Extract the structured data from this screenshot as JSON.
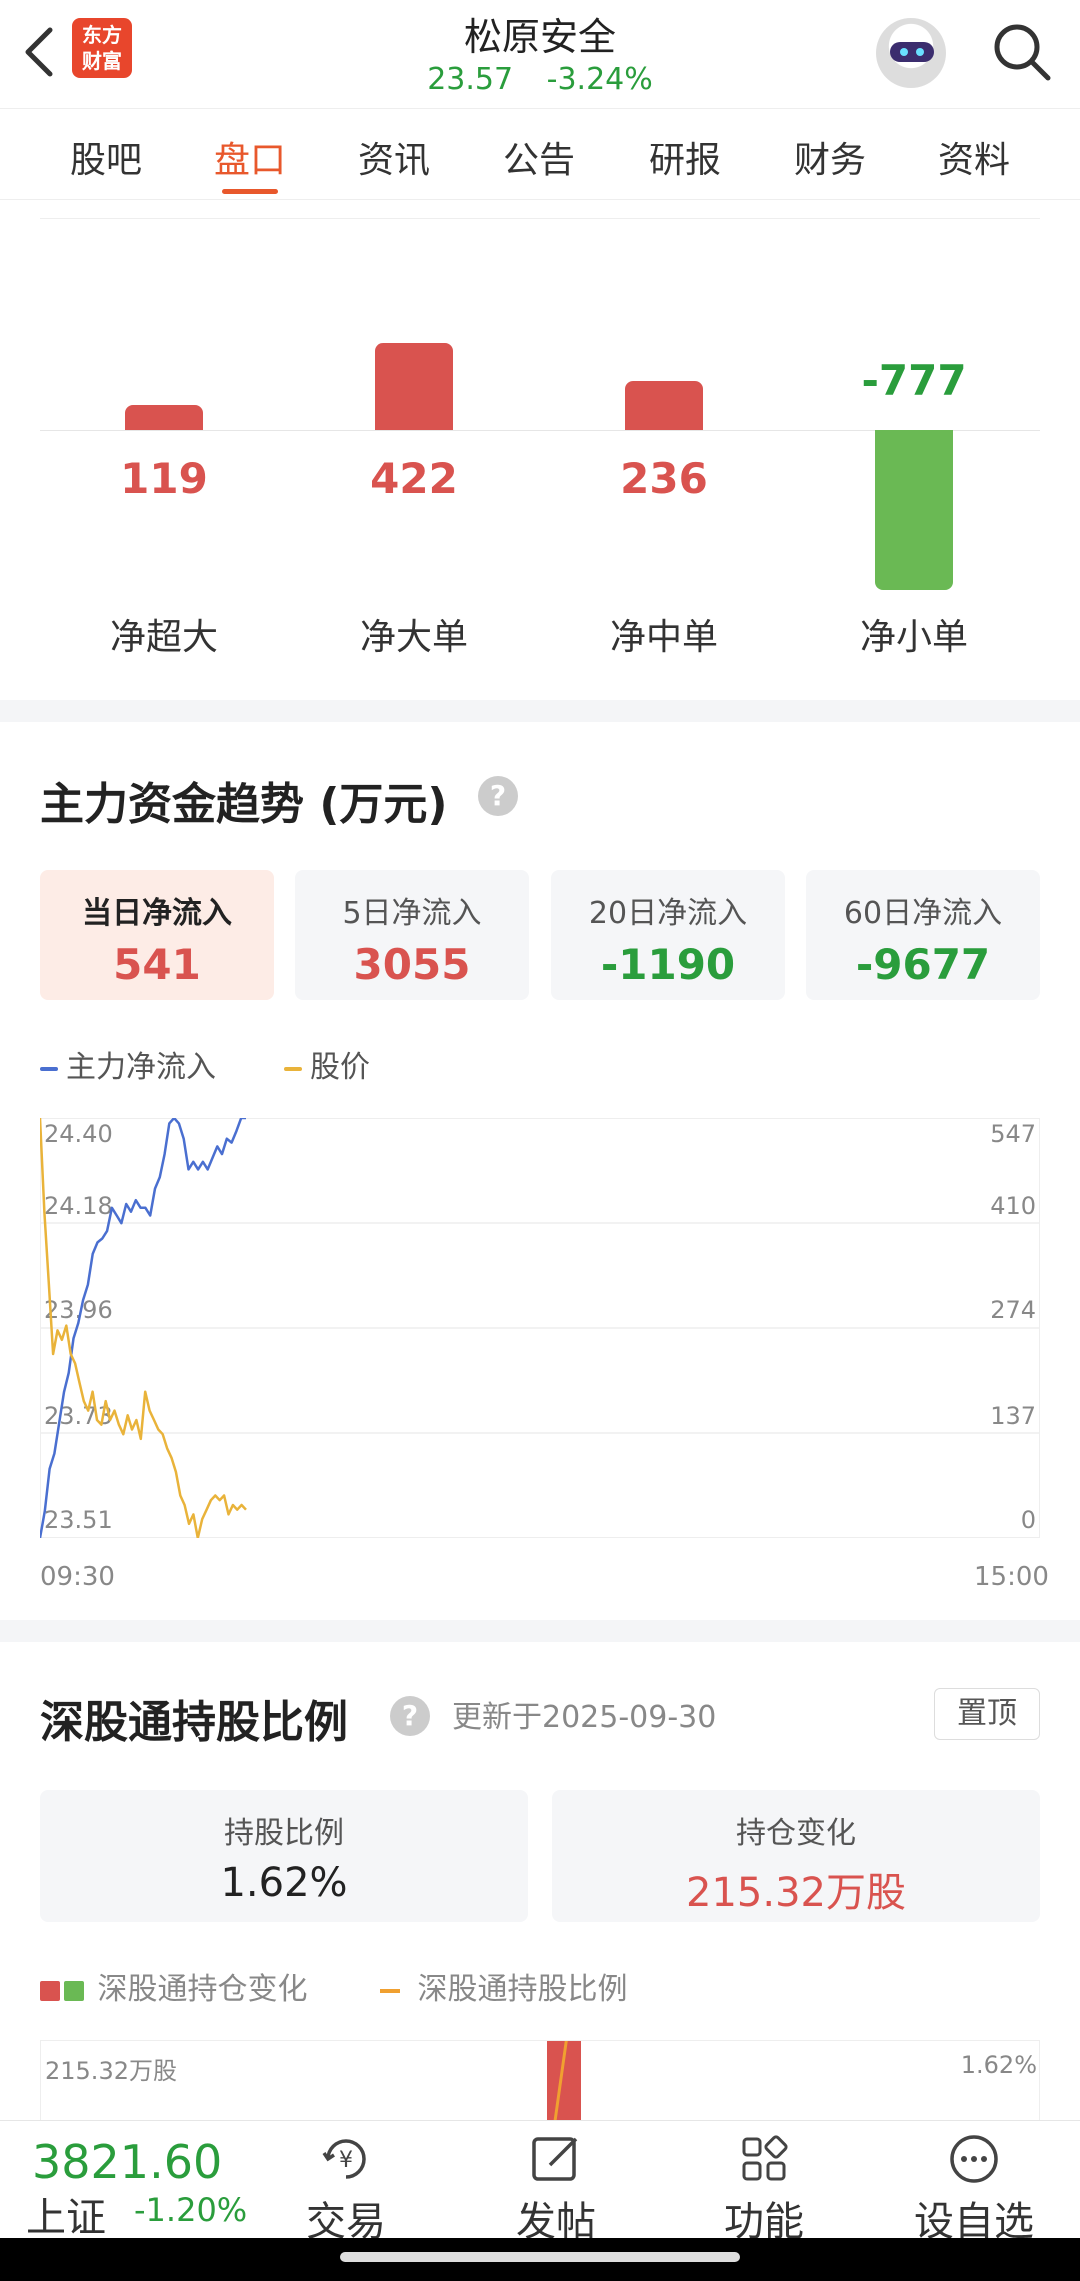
{
  "header": {
    "logo_lines": [
      "东方",
      "财富"
    ],
    "stock_name": "松原安全",
    "price": "23.57",
    "change_pct": "-3.24%"
  },
  "tabs": [
    "股吧",
    "盘口",
    "资讯",
    "公告",
    "研报",
    "财务",
    "资料"
  ],
  "active_tab": "盘口",
  "flow_bars": [
    {
      "label": "净超大",
      "value": 119
    },
    {
      "label": "净大单",
      "value": 422
    },
    {
      "label": "净中单",
      "value": 236
    },
    {
      "label": "净小单",
      "value": -777
    }
  ],
  "trend": {
    "title": "主力资金趋势 (万元)",
    "help": "?",
    "cards": [
      {
        "label": "当日净流入",
        "value": "541"
      },
      {
        "label": "5日净流入",
        "value": "3055"
      },
      {
        "label": "20日净流入",
        "value": "-1190"
      },
      {
        "label": "60日净流入",
        "value": "-9677"
      }
    ],
    "legend": [
      "主力净流入",
      "股价"
    ],
    "time_start": "09:30",
    "time_end": "15:00"
  },
  "chart_data": {
    "type": "line",
    "title": "",
    "x_range": [
      "09:30",
      "15:00"
    ],
    "y_left_ticks": [
      "24.40",
      "24.18",
      "23.96",
      "23.73",
      "23.51"
    ],
    "y_right_ticks": [
      "547",
      "410",
      "274",
      "137",
      "0"
    ],
    "y_left_lim": [
      23.51,
      24.4
    ],
    "y_right_lim": [
      0,
      547
    ],
    "series": [
      {
        "name": "主力净流入",
        "axis": "right",
        "color": "#4a6fd0",
        "values": [
          0,
          35,
          90,
          110,
          150,
          190,
          215,
          260,
          280,
          310,
          330,
          370,
          385,
          390,
          400,
          430,
          420,
          410,
          435,
          425,
          440,
          430,
          430,
          420,
          455,
          470,
          500,
          540,
          547,
          540,
          520,
          480,
          490,
          480,
          490,
          480,
          495,
          510,
          500,
          520,
          515,
          530,
          547,
          547
        ]
      },
      {
        "name": "股价",
        "axis": "left",
        "color": "#e9b33a",
        "values": [
          24.4,
          24.2,
          24.05,
          23.9,
          23.95,
          23.93,
          23.96,
          23.9,
          23.88,
          23.84,
          23.8,
          23.78,
          23.82,
          23.76,
          23.75,
          23.8,
          23.76,
          23.78,
          23.75,
          23.73,
          23.77,
          23.74,
          23.76,
          23.72,
          23.82,
          23.78,
          23.76,
          23.74,
          23.73,
          23.7,
          23.68,
          23.65,
          23.6,
          23.58,
          23.54,
          23.56,
          23.51,
          23.55,
          23.57,
          23.59,
          23.6,
          23.59,
          23.6,
          23.56,
          23.58,
          23.57,
          23.58,
          23.57
        ]
      }
    ]
  },
  "hk_connect": {
    "title": "深股通持股比例",
    "help": "?",
    "updated": "更新于2025-09-30",
    "pin_label": "置顶",
    "cards": [
      {
        "label": "持股比例",
        "value": "1.62%"
      },
      {
        "label": "持仓变化",
        "value": "215.32万股"
      }
    ],
    "legend": [
      "深股通持仓变化",
      "深股通持股比例"
    ],
    "axis_left_top": "215.32万股",
    "axis_right_top": "1.62%"
  },
  "bottom_bar": {
    "index_value": "3821.60",
    "index_name": "上证",
    "index_change": "-1.20%",
    "nav": [
      {
        "label": "交易",
        "icon": "trade-icon"
      },
      {
        "label": "发帖",
        "icon": "compose-icon"
      },
      {
        "label": "功能",
        "icon": "grid-icon"
      },
      {
        "label": "设自选",
        "icon": "more-icon"
      }
    ]
  },
  "colors": {
    "up": "#d9534f",
    "down": "#2a9d3c",
    "bar_down": "#6ab954",
    "accent": "#e8582c",
    "inflow_line": "#4a6fd0",
    "price_line": "#e9b33a"
  }
}
